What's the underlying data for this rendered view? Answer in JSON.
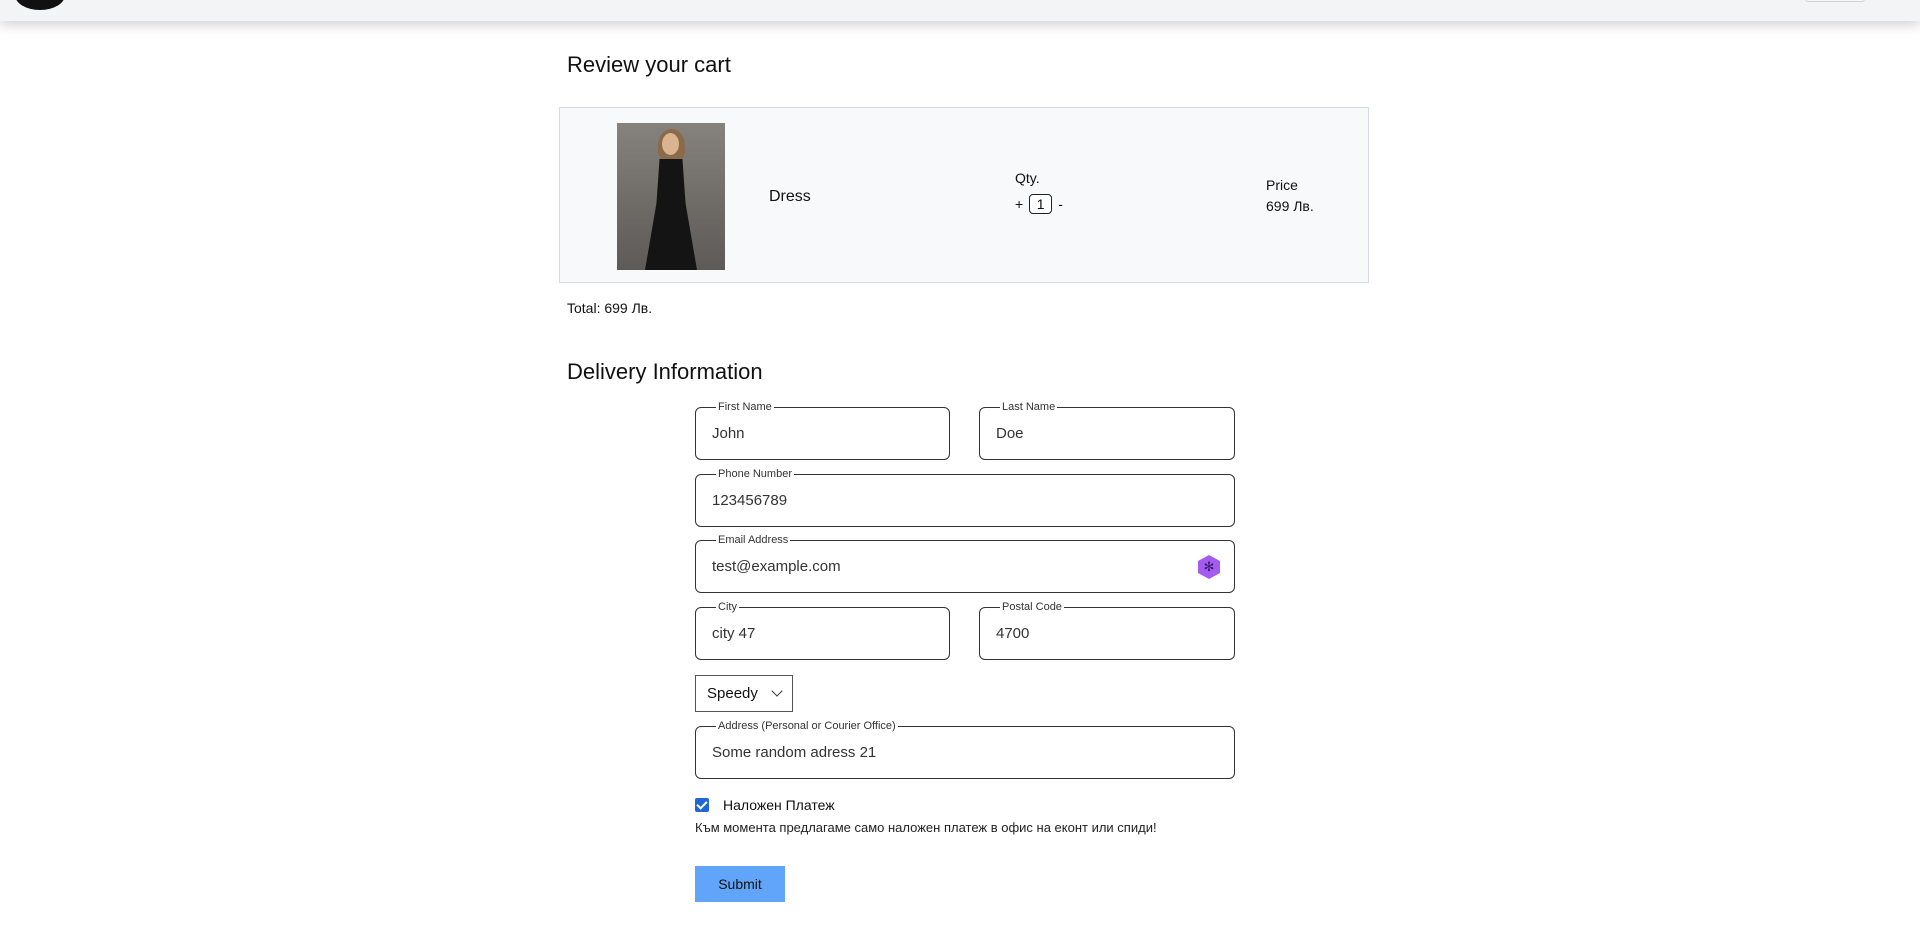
{
  "cart": {
    "title": "Review your cart",
    "items": [
      {
        "name": "Dress",
        "qty_label": "Qty.",
        "qty_plus": "+",
        "qty_value": "1",
        "qty_minus": "-",
        "price_label": "Price",
        "price": "699 Лв."
      }
    ],
    "total": "Total: 699 Лв."
  },
  "delivery": {
    "title": "Delivery Information",
    "first_name": {
      "label": "First Name",
      "value": "John"
    },
    "last_name": {
      "label": "Last Name",
      "value": "Doe"
    },
    "phone": {
      "label": "Phone Number",
      "value": "123456789"
    },
    "email": {
      "label": "Email Address",
      "value": "test@example.com"
    },
    "city": {
      "label": "City",
      "value": "city 47"
    },
    "postal": {
      "label": "Postal Code",
      "value": "4700"
    },
    "courier": {
      "selected": "Speedy"
    },
    "address": {
      "label": "Address (Personal or Courier Office)",
      "value": "Some random adress 21"
    },
    "cod_checkbox": {
      "label": "Наложен Платеж",
      "checked": true
    },
    "note": "Към момента предлагаме само наложен платеж в офис на еконт или спиди!",
    "submit_label": "Submit"
  },
  "icons": {
    "email_field_icon": "extension-hex-icon",
    "select_icon": "chevron-down-icon"
  },
  "colors": {
    "accent": "#60a5fa",
    "checkbox": "#1f66d6"
  }
}
